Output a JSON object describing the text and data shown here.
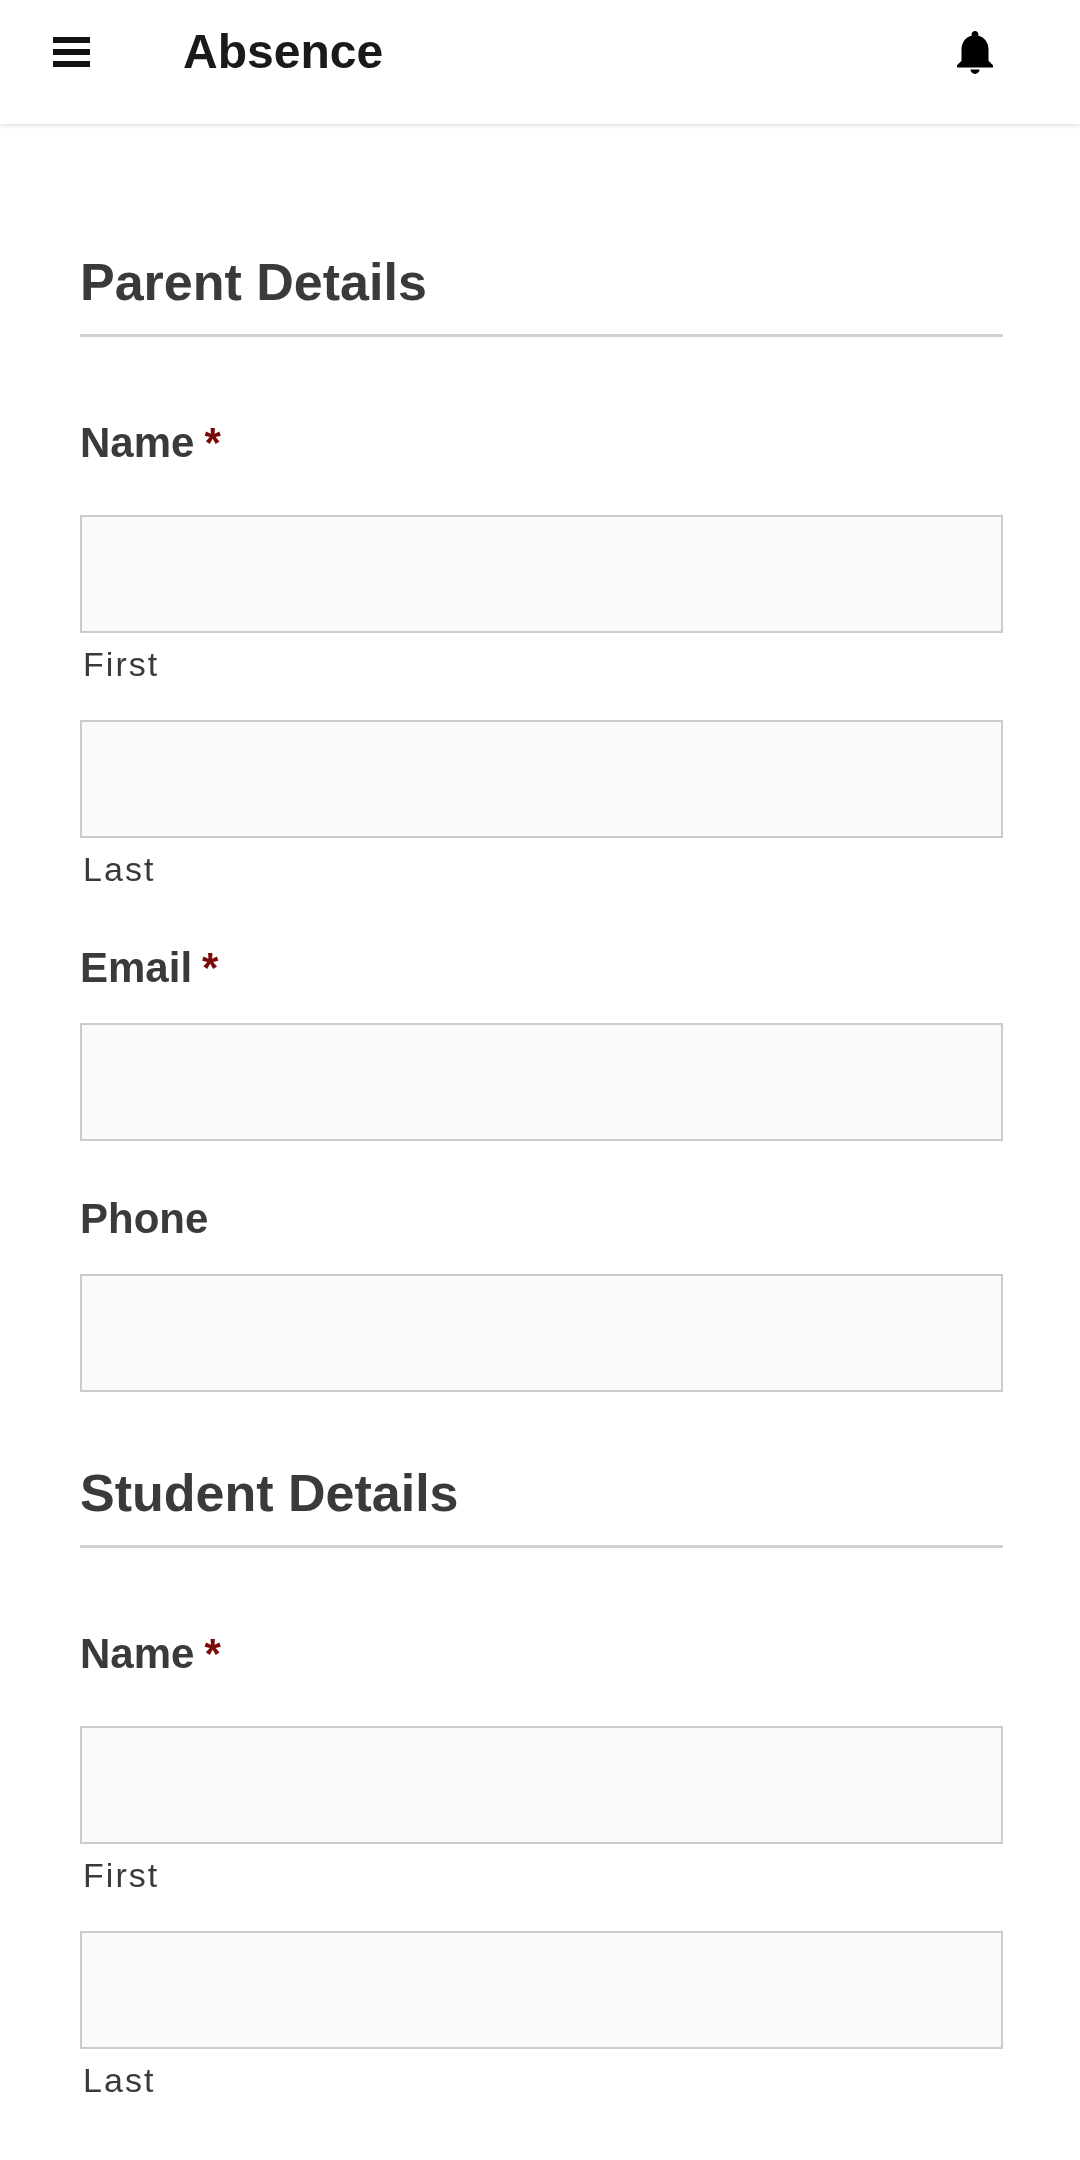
{
  "app_bar": {
    "title": "Absence"
  },
  "sections": [
    {
      "title": "Parent Details",
      "fields": [
        {
          "kind": "name",
          "label": "Name",
          "required_mark": "*",
          "subfields": [
            {
              "sublabel": "First"
            },
            {
              "sublabel": "Last"
            }
          ]
        },
        {
          "kind": "single",
          "label": "Email",
          "required_mark": "*"
        },
        {
          "kind": "single",
          "label": "Phone"
        }
      ]
    },
    {
      "title": "Student Details",
      "fields": [
        {
          "kind": "name",
          "label": "Name",
          "required_mark": "*",
          "subfields": [
            {
              "sublabel": "First"
            },
            {
              "sublabel": "Last"
            }
          ]
        }
      ]
    }
  ]
}
